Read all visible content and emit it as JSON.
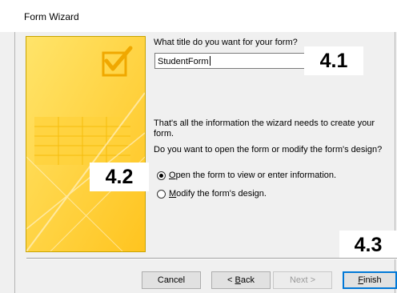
{
  "window": {
    "title": "Form Wizard"
  },
  "prompt": {
    "title_question": "What title do you want for your form?"
  },
  "form_title_input": {
    "value": "StudentForm"
  },
  "info": {
    "line1": "That's all the information the wizard needs to create your",
    "line2": "form.",
    "question": "Do you want to open the form or modify the form's design?"
  },
  "options": [
    {
      "label": "Open the form to view or enter information.",
      "mnemonic": "O",
      "rest": "pen the form to view or enter information.",
      "selected": true
    },
    {
      "label": "Modify the form's design.",
      "mnemonic": "M",
      "rest": "odify the form's design.",
      "selected": false
    }
  ],
  "callouts": {
    "c1": "4.1",
    "c2": "4.2",
    "c3": "4.3"
  },
  "buttons": {
    "cancel": "Cancel",
    "back_prefix": "< ",
    "back_mnemonic": "B",
    "back_rest": "ack",
    "next": "Next >",
    "finish_mnemonic": "F",
    "finish_rest": "inish"
  },
  "colors": {
    "art_bg": "#ffd335",
    "art_accent": "#f0a800",
    "default_button_border": "#0078d7"
  }
}
